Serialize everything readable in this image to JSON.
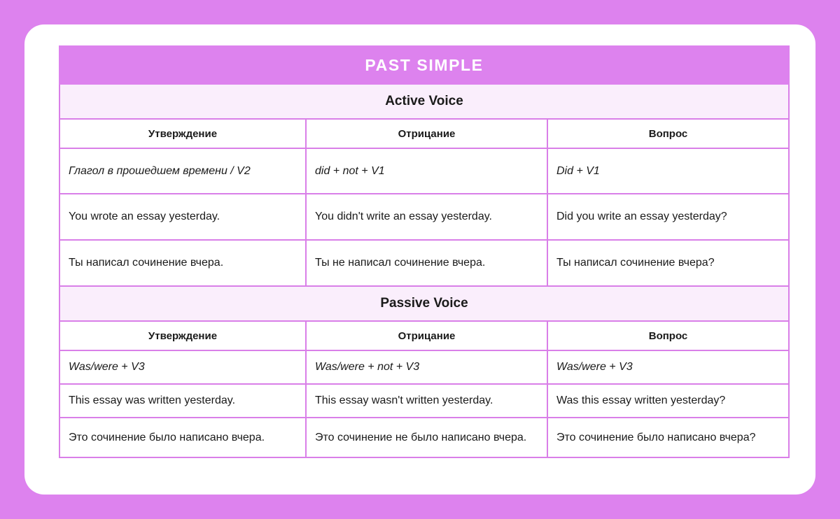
{
  "title": "PAST SIMPLE",
  "theme": {
    "page_background": "#dd82ee",
    "card_background": "#ffffff",
    "title_bar": "#dd82ee",
    "title_text": "#ffffff",
    "band_background": "#faeefc",
    "border": "#d97fe8",
    "text": "#1a1a1a"
  },
  "sections": [
    {
      "voice": "Active Voice",
      "headers": [
        "Утверждение",
        "Отрицание",
        "Вопрос"
      ],
      "rows": [
        {
          "style": "formula",
          "cells": [
            "Глагол в прошедшем времени / V2",
            "did + not + V1",
            "Did + V1"
          ]
        },
        {
          "style": "sentence",
          "cells": [
            "You wrote an essay yesterday.",
            "You didn't write an essay yesterday.",
            "Did you write an essay yesterday?"
          ]
        },
        {
          "style": "sentence",
          "cells": [
            "Ты написал сочинение вчера.",
            "Ты не написал сочинение вчера.",
            "Ты написал сочинение вчера?"
          ]
        }
      ]
    },
    {
      "voice": "Passive Voice",
      "headers": [
        "Утверждение",
        "Отрицание",
        "Вопрос"
      ],
      "rows": [
        {
          "style": "formula",
          "cells": [
            "Was/were + V3",
            "Was/were + not + V3",
            "Was/were + V3"
          ]
        },
        {
          "style": "sentence",
          "cells": [
            "This essay was written yesterday.",
            "This essay wasn't written yesterday.",
            "Was this essay written yesterday?"
          ]
        },
        {
          "style": "sentence",
          "cells": [
            "Это сочинение было написано вчера.",
            "Это сочинение не было написано вчера.",
            "Это сочинение было написано вчера?"
          ]
        }
      ]
    }
  ]
}
